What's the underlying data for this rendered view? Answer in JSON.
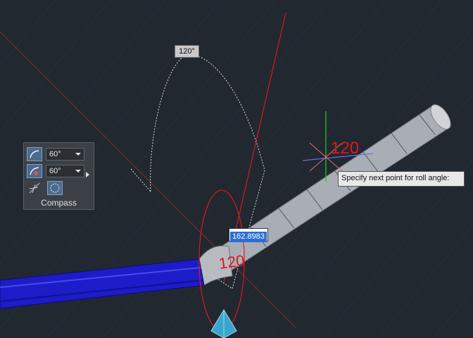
{
  "viewport": {
    "background": "#212830",
    "angle_tag": "120°",
    "dimension_label_upper": "120",
    "dimension_label_lower": "120",
    "dynamic_input_value": "162.8983",
    "tooltip": "Specify next point for roll angle:"
  },
  "compass_panel": {
    "title": "Compass",
    "snap_angle_1": "60°",
    "snap_angle_2": "60°",
    "icons": [
      "arc-snap-icon",
      "arc-radius-icon",
      "compass-lines-icon",
      "compass-toggle-icon"
    ]
  },
  "colors": {
    "pipe_blue": "#1c1cc8",
    "pipe_grey": "#a8adb5",
    "red_axis": "#e01818",
    "green_axis": "#28c828"
  }
}
